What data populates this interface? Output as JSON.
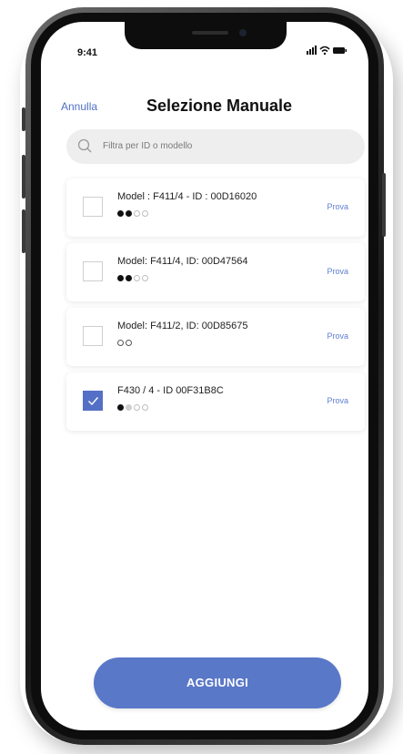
{
  "status_bar": {
    "time": "9:41"
  },
  "header": {
    "cancel_label": "Annulla",
    "title": "Selezione Manuale"
  },
  "search": {
    "placeholder": "Filtra per ID o modello",
    "value": ""
  },
  "devices": [
    {
      "label": "Model : F411/4 - ID : 00D16020",
      "checked": false,
      "try_label": "Prova",
      "dots": [
        "filled",
        "filled",
        "empty",
        "empty"
      ]
    },
    {
      "label": "Model: F411/4, ID: 00D47564",
      "checked": false,
      "try_label": "Prova",
      "dots": [
        "filled",
        "filled",
        "empty",
        "empty"
      ]
    },
    {
      "label": "Model: F411/2, ID: 00D85675",
      "checked": false,
      "try_label": "Prova",
      "dots": [
        "outline-dark",
        "outline-dark"
      ]
    },
    {
      "label": "F430 / 4 - ID 00F31B8C",
      "checked": true,
      "try_label": "Prova",
      "dots": [
        "filled",
        "gray",
        "empty",
        "empty"
      ]
    }
  ],
  "footer": {
    "add_label": "AGGIUNGI"
  },
  "colors": {
    "accent": "#5470c6",
    "link": "#4f6fc6",
    "button": "#5a78c8"
  }
}
